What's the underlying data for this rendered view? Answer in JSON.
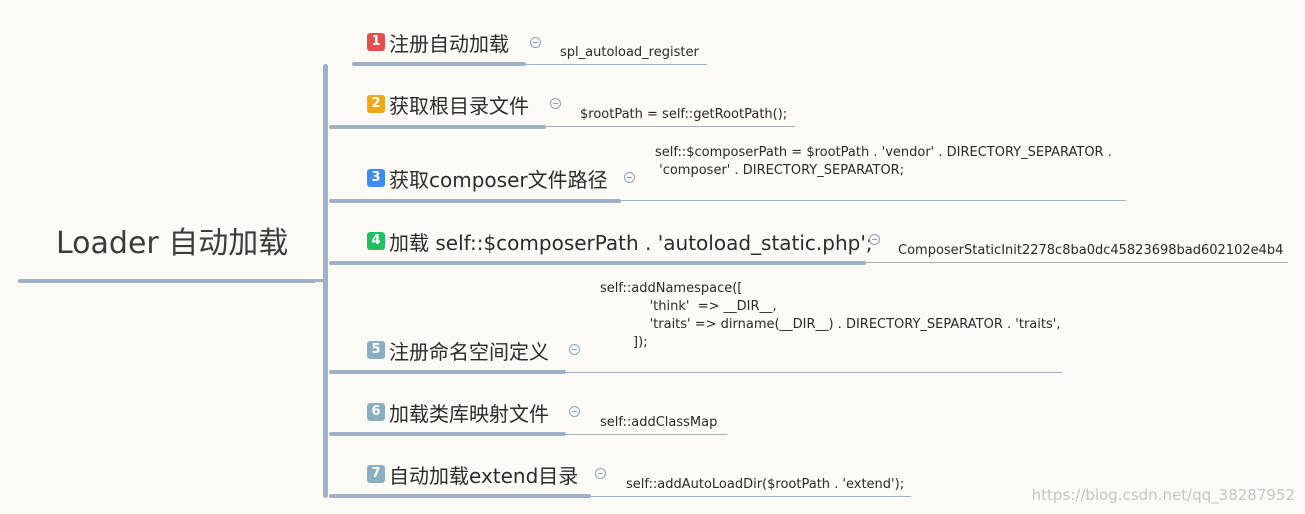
{
  "root": {
    "label": "Loader 自动加载"
  },
  "topics": [
    {
      "number": "1",
      "label": "注册自动加载",
      "color": "#e05050",
      "note": "spl_autoload_register"
    },
    {
      "number": "2",
      "label": "获取根目录文件",
      "color": "#f0a818",
      "note": "$rootPath = self::getRootPath();"
    },
    {
      "number": "3",
      "label": "获取composer文件路径",
      "color": "#3c8cf0",
      "note": "self::$composerPath = $rootPath . 'vendor' . DIRECTORY_SEPARATOR .\n 'composer' . DIRECTORY_SEPARATOR;"
    },
    {
      "number": "4",
      "label": "加载 self::$composerPath . 'autoload_static.php';",
      "color": "#20c060",
      "note": "ComposerStaticInit2278c8ba0dc45823698bad602102e4b4"
    },
    {
      "number": "5",
      "label": "注册命名空间定义",
      "color": "#8aafc0",
      "note": "self::addNamespace([\n            'think'  => __DIR__,\n            'traits' => dirname(__DIR__) . DIRECTORY_SEPARATOR . 'traits',\n        ]);"
    },
    {
      "number": "6",
      "label": "加载类库映射文件",
      "color": "#8aafc0",
      "note": "self::addClassMap"
    },
    {
      "number": "7",
      "label": "自动加载extend目录",
      "color": "#8aafc0",
      "note": "self::addAutoLoadDir($rootPath . 'extend');"
    }
  ],
  "watermark": "https://blog.csdn.net/qq_38287952"
}
